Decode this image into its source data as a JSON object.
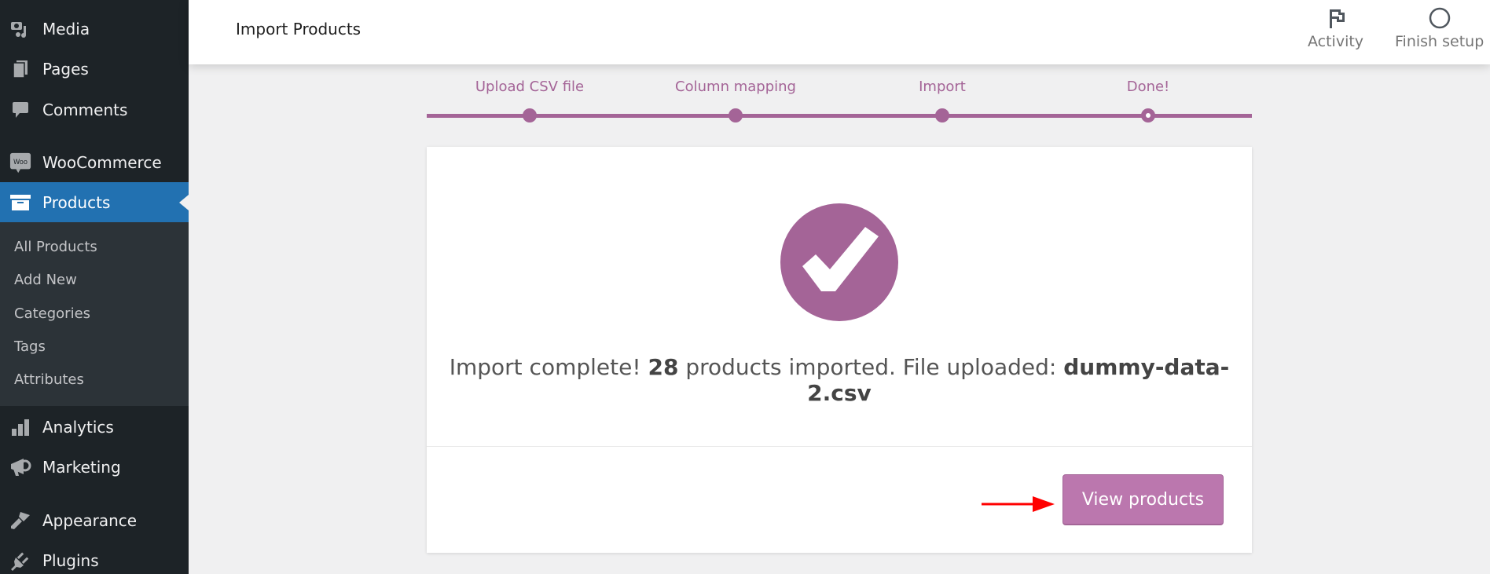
{
  "sidebar": {
    "items": [
      {
        "label": "Media",
        "icon": "media-icon"
      },
      {
        "label": "Pages",
        "icon": "pages-icon"
      },
      {
        "label": "Comments",
        "icon": "comments-icon"
      },
      {
        "label": "WooCommerce",
        "icon": "woocommerce-icon"
      },
      {
        "label": "Products",
        "icon": "products-icon",
        "active": true
      },
      {
        "label": "Analytics",
        "icon": "analytics-icon"
      },
      {
        "label": "Marketing",
        "icon": "marketing-icon"
      },
      {
        "label": "Appearance",
        "icon": "appearance-icon"
      },
      {
        "label": "Plugins",
        "icon": "plugins-icon"
      }
    ],
    "submenu": [
      "All Products",
      "Add New",
      "Categories",
      "Tags",
      "Attributes"
    ]
  },
  "header": {
    "title": "Import Products",
    "activity_label": "Activity",
    "finish_setup_label": "Finish setup"
  },
  "stepper": {
    "steps": [
      "Upload CSV file",
      "Column mapping",
      "Import",
      "Done!"
    ],
    "current_step": 4
  },
  "result": {
    "prefix": "Import complete!",
    "count": "28",
    "middle": "products imported. File uploaded:",
    "filename": "dummy-data-2.csv"
  },
  "actions": {
    "view_products_label": "View products"
  },
  "colors": {
    "accent": "#a46497",
    "button": "#bb77ae",
    "sidebar_bg": "#1d2327",
    "sidebar_active": "#2271b1",
    "annotation_arrow": "#ff0000"
  }
}
